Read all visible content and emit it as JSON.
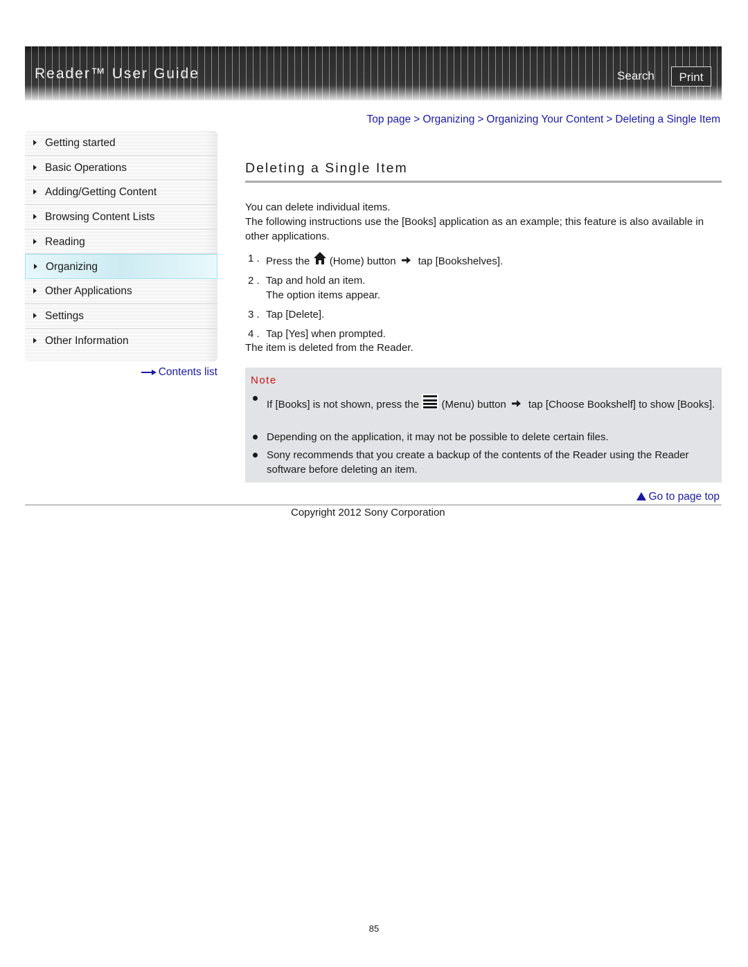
{
  "header": {
    "title": "Reader™ User Guide",
    "search_label": "Search",
    "print_label": "Print"
  },
  "breadcrumb": [
    {
      "label": "Top page"
    },
    {
      "label": "Organizing"
    },
    {
      "label": "Organizing Your Content"
    },
    {
      "label": "Deleting a Single Item"
    }
  ],
  "breadcrumb_separator": ">",
  "sidebar": {
    "items": [
      {
        "label": "Getting started",
        "active": false
      },
      {
        "label": "Basic Operations",
        "active": false
      },
      {
        "label": "Adding/Getting Content",
        "active": false
      },
      {
        "label": "Browsing Content Lists",
        "active": false
      },
      {
        "label": "Reading",
        "active": false
      },
      {
        "label": "Organizing",
        "active": true
      },
      {
        "label": "Other Applications",
        "active": false
      },
      {
        "label": "Settings",
        "active": false
      },
      {
        "label": "Other Information",
        "active": false
      }
    ],
    "contents_link": "Contents list"
  },
  "main": {
    "title": "Deleting a Single Item",
    "intro": [
      "You can delete individual items.",
      "The following instructions use the [Books] application as an example; this feature is also available in other applications."
    ],
    "steps": [
      {
        "num": "1 .",
        "pre": "Press the",
        "icon": "home-icon",
        "mid": "(Home) button",
        "arrow": "right-arrow-icon",
        "post": "tap [Bookshelves]."
      },
      {
        "num": "2 .",
        "line1": "Tap and hold an item.",
        "line2": "The option items appear."
      },
      {
        "num": "3 .",
        "text": "Tap [Delete]."
      },
      {
        "num": "4 .",
        "text": "Tap [Yes] when prompted."
      }
    ],
    "result": "The item is deleted from the Reader.",
    "note": {
      "title": "Note",
      "items": [
        {
          "pre": "If [Books] is not shown, press the",
          "icon": "menu-icon",
          "mid": "(Menu) button",
          "arrow": "right-arrow-icon",
          "post": "tap [Choose Bookshelf] to show [Books]."
        },
        {
          "text": "Depending on the application, it may not be possible to delete certain files."
        },
        {
          "text": "Sony recommends that you create a backup of the contents of the Reader using the Reader software before deleting an item."
        }
      ]
    }
  },
  "footer": {
    "go_top": "Go to page top",
    "copyright": "Copyright 2012 Sony Corporation",
    "page_number": "85"
  },
  "colors": {
    "link": "#1a1aa0",
    "note_title": "#cc1111",
    "note_bg": "#e1e3e6",
    "active_item_bg": "#d6f0f6"
  }
}
